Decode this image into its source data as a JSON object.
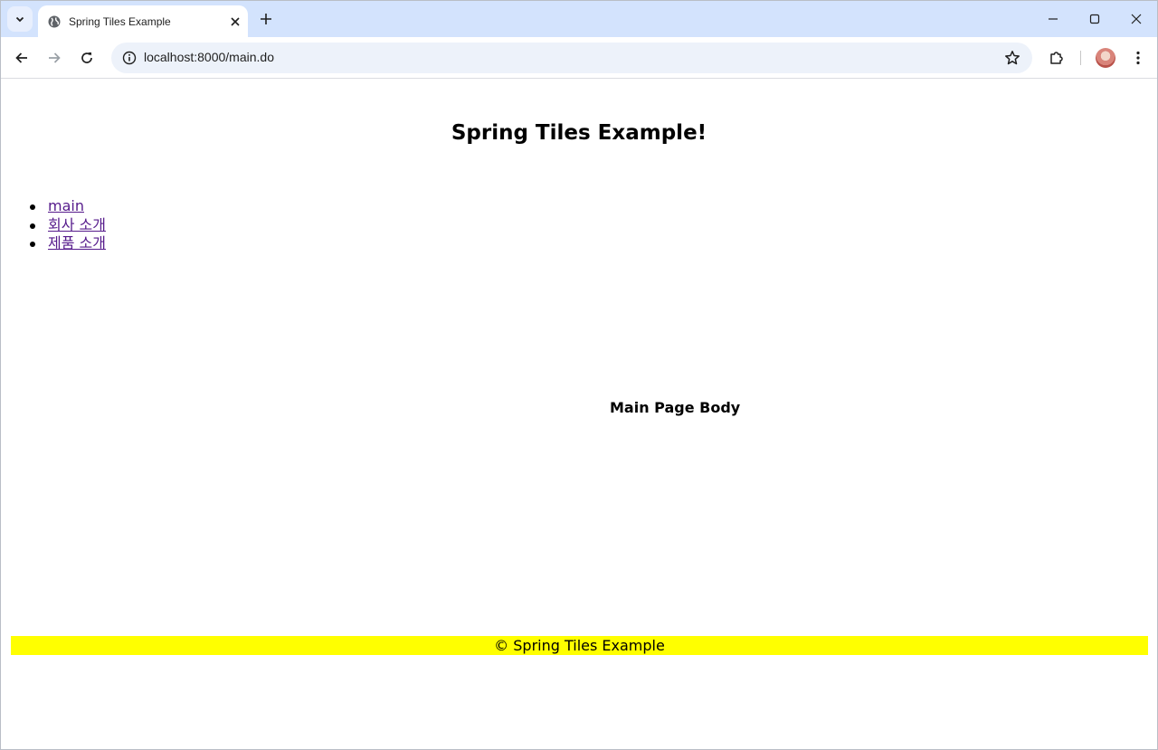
{
  "browser": {
    "tab_title": "Spring Tiles Example",
    "url": "localhost:8000/main.do"
  },
  "page": {
    "header": "Spring Tiles Example!",
    "menu": [
      {
        "label": "main"
      },
      {
        "label": "회사 소개"
      },
      {
        "label": "제품 소개"
      }
    ],
    "body": "Main Page Body",
    "footer": "© Spring Tiles Example"
  },
  "colors": {
    "footer_background": "#ffff00",
    "link_visited": "#551a8b",
    "tabstrip": "#d3e3fd"
  },
  "icons": [
    "tab-search-icon",
    "globe-icon",
    "close-icon",
    "plus-icon",
    "minimize-icon",
    "maximize-icon",
    "window-close-icon",
    "back-icon",
    "forward-icon",
    "reload-icon",
    "info-icon",
    "star-icon",
    "extensions-icon",
    "kebab-menu-icon"
  ]
}
